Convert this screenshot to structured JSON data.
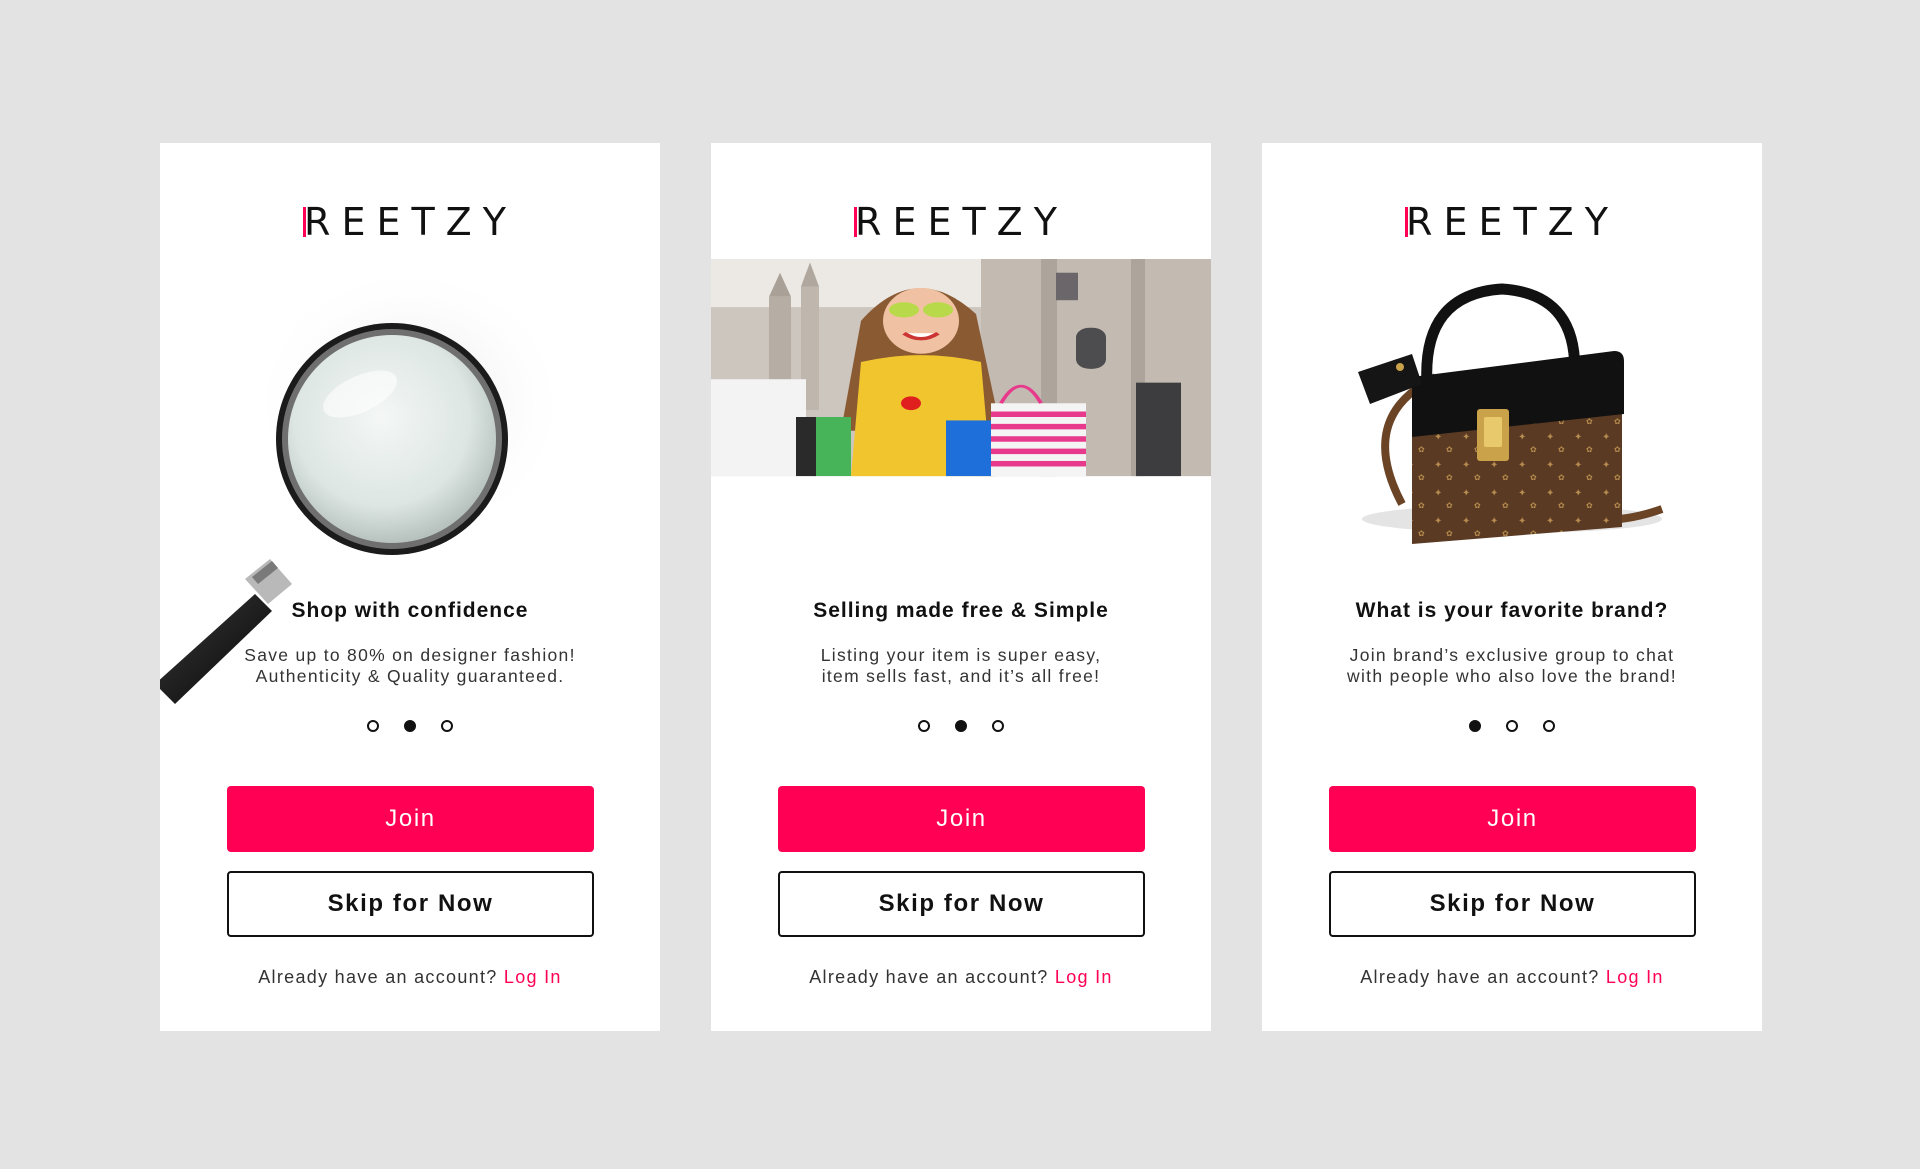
{
  "colors": {
    "accent": "#ff0054",
    "background": "#e3e3e3",
    "card": "#ffffff",
    "text": "#111111"
  },
  "cards": [
    {
      "logo": "REETZY",
      "image": "magnifying-glass",
      "title": "Shop with confidence",
      "desc_line1": "Save up to 80% on designer fashion!",
      "desc_line2": "Authenticity & Quality guaranteed.",
      "active_dot": 2,
      "join_label": "Join",
      "skip_label": "Skip for Now",
      "login_prompt": "Already have an account?",
      "login_link": "Log In"
    },
    {
      "logo": "REETZY",
      "image": "woman-with-shopping-bags",
      "title": "Selling made free & Simple",
      "desc_line1": "Listing your item is super easy,",
      "desc_line2": "item sells fast, and it’s all free!",
      "active_dot": 2,
      "join_label": "Join",
      "skip_label": "Skip for Now",
      "login_prompt": "Already have an account?",
      "login_link": "Log In"
    },
    {
      "logo": "REETZY",
      "image": "designer-handbag",
      "title": "What is your favorite brand?",
      "desc_line1": "Join brand’s exclusive group to chat",
      "desc_line2": "with people who also love the brand!",
      "active_dot": 1,
      "join_label": "Join",
      "skip_label": "Skip for Now",
      "login_prompt": "Already have an account?",
      "login_link": "Log In"
    }
  ]
}
